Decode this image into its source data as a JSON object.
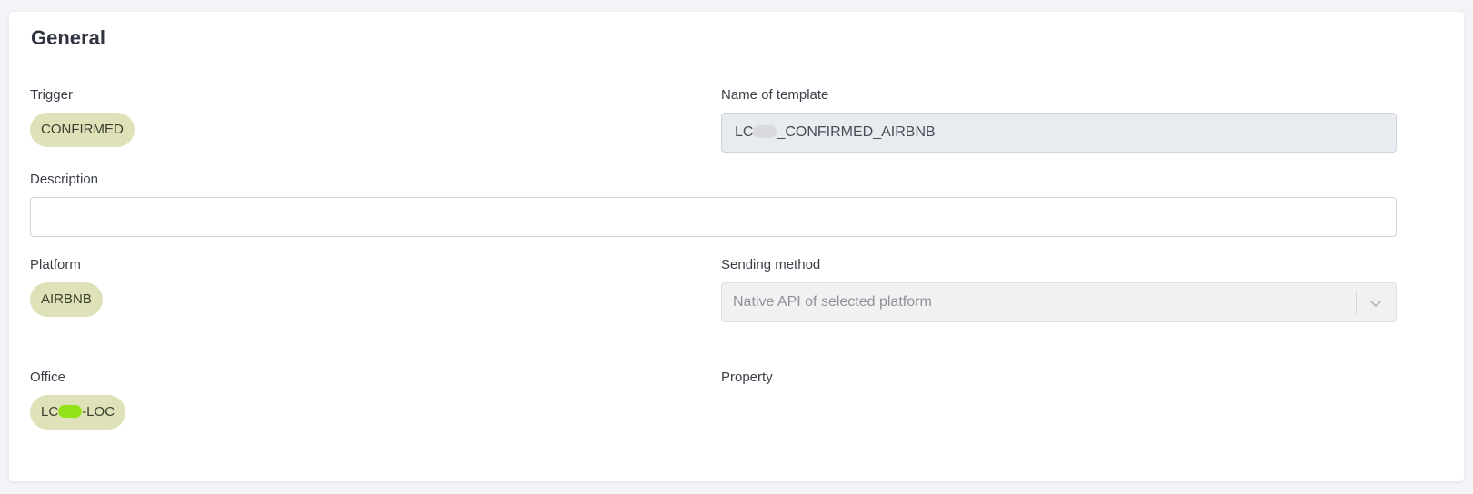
{
  "section": {
    "title": "General"
  },
  "trigger": {
    "label": "Trigger",
    "value": "CONFIRMED"
  },
  "template_name": {
    "label": "Name of template",
    "value_prefix": "LC",
    "value_suffix": "_CONFIRMED_AIRBNB"
  },
  "description": {
    "label": "Description",
    "value": ""
  },
  "platform": {
    "label": "Platform",
    "value": "AIRBNB"
  },
  "sending_method": {
    "label": "Sending method",
    "selected": "Native API of selected platform",
    "icon": "chevron-down-icon"
  },
  "office": {
    "label": "Office",
    "value_prefix": "LC",
    "value_suffix": "-LOC"
  },
  "property": {
    "label": "Property"
  },
  "colors": {
    "chip_background": "#dfe2b8",
    "readonly_field": "#e8ebef",
    "redaction_gray": "#d9dadd",
    "redaction_green": "#93e21a"
  }
}
